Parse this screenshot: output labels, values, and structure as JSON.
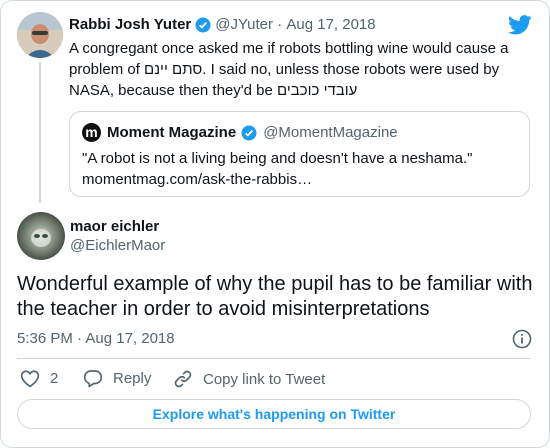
{
  "reply_to": {
    "author_name": "Rabbi Josh Yuter",
    "handle": "@JYuter",
    "date": "Aug 17, 2018",
    "text_line1": "A congregant once asked me if robots bottling wine would cause a",
    "text_line2": "problem of סתם יינם. I said no, unless those robots were used by",
    "text_line3": "NASA, because then they'd be עובדי כוכבים"
  },
  "quoted": {
    "author_name": "Moment Magazine",
    "handle": "@MomentMagazine",
    "text": "\"A robot is not a living being and doesn't have a neshama.\"",
    "link": "momentmag.com/ask-the-rabbis…"
  },
  "tweet": {
    "author_name": "maor eichler",
    "handle": "@EichlerMaor",
    "text_line1": "Wonderful example of why the pupil has to be familiar with",
    "text_line2": "the teacher in order to avoid misinterpretations",
    "time": "5:36 PM · Aug 17, 2018"
  },
  "actions": {
    "likes": "2",
    "reply_label": "Reply",
    "copy_link_label": "Copy link to Tweet"
  },
  "explore_label": "Explore what's happening on Twitter",
  "colors": {
    "accent": "#1d9bf0",
    "verified": "#1d9bf0",
    "muted": "#536471",
    "border": "#cfd9de"
  },
  "icons": [
    "twitter-bird-icon",
    "verified-badge-icon",
    "heart-icon",
    "reply-icon",
    "link-icon",
    "info-icon"
  ]
}
